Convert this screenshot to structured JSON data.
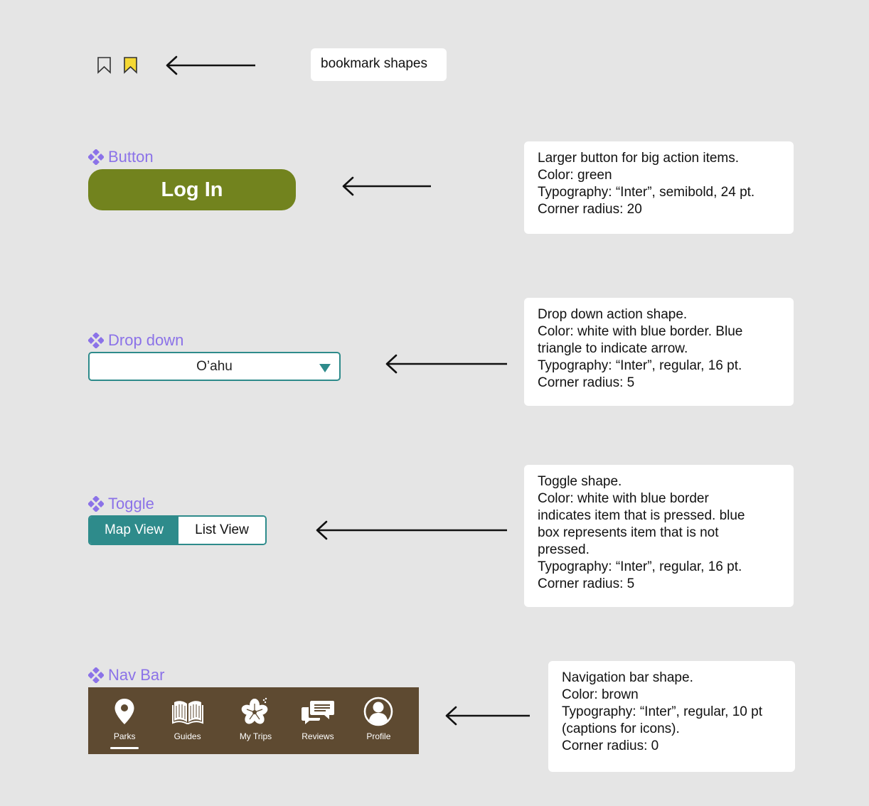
{
  "bookmarks": {
    "note": "bookmark shapes",
    "colors": {
      "outline": "#333333",
      "filled": "#f5d833",
      "filled_stroke": "#333333"
    }
  },
  "button_section": {
    "label": "Button",
    "button_text": "Log In",
    "color": "#72831e",
    "note_lines": [
      "Larger button for big action items.",
      "Color: green",
      "Typography: “Inter”, semibold, 24 pt.",
      "Corner radius: 20"
    ]
  },
  "dropdown_section": {
    "label": "Drop down",
    "selected_value": "O’ahu",
    "border_color": "#2e8b8b",
    "note_lines": [
      "Drop down action shape.",
      "Color: white with blue border. Blue",
      "triangle to indicate arrow.",
      "Typography: “Inter”, regular, 16 pt.",
      "Corner radius: 5"
    ]
  },
  "toggle_section": {
    "label": "Toggle",
    "options": [
      "Map View",
      "List View"
    ],
    "accent_color": "#2e8b8b",
    "note_lines": [
      "Toggle shape.",
      "Color: white with blue border",
      "indicates item that is pressed. blue",
      "box represents item that is not",
      "pressed.",
      "Typography: “Inter”, regular, 16 pt.",
      "Corner radius: 5"
    ]
  },
  "navbar_section": {
    "label": "Nav Bar",
    "color": "#5e4a31",
    "items": [
      {
        "label": "Parks",
        "icon": "map-pin-icon",
        "active": true
      },
      {
        "label": "Guides",
        "icon": "book-icon",
        "active": false
      },
      {
        "label": "My Trips",
        "icon": "hibiscus-icon",
        "active": false
      },
      {
        "label": "Reviews",
        "icon": "chat-bubbles-icon",
        "active": false
      },
      {
        "label": "Profile",
        "icon": "user-circle-icon",
        "active": false
      }
    ],
    "note_lines": [
      "Navigation bar shape.",
      "Color: brown",
      "Typography: “Inter”, regular, 10 pt",
      "(captions for icons).",
      "Corner radius: 0"
    ]
  },
  "component_label_color": "#8b72e8"
}
